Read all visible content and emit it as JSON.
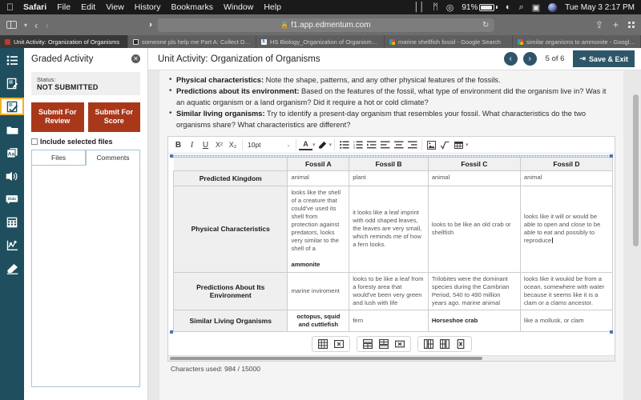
{
  "menubar": {
    "apple": "apple-logo",
    "items": [
      {
        "label": "Safari",
        "bold": true
      },
      {
        "label": "File",
        "bold": false
      },
      {
        "label": "Edit",
        "bold": false
      },
      {
        "label": "View",
        "bold": false
      },
      {
        "label": "History",
        "bold": false
      },
      {
        "label": "Bookmarks",
        "bold": false
      },
      {
        "label": "Window",
        "bold": false
      },
      {
        "label": "Help",
        "bold": false
      }
    ],
    "status": {
      "airplay_glyph": "⑂",
      "bluetooth_glyph": "ᛗ",
      "timemachine_glyph": "◔",
      "battery_pct": "91%",
      "wifi_glyph": "◠",
      "search_glyph": "⌕",
      "controlcenter_glyph": "☷",
      "siri": "siri-dot",
      "datetime": "Tue May 3  2:17 PM"
    }
  },
  "browser": {
    "url": "f1.app.edmentum.com",
    "lock_glyph": "🔒",
    "reload_glyph": "↻",
    "back_glyph": "‹",
    "forward_glyph": "›",
    "share_glyph": "↑",
    "newtab_glyph": "+",
    "chevron_glyph": "⌄",
    "shield_glyph": "◑",
    "tabs": [
      {
        "label": "Unit Activity: Organization of Organisms",
        "favicon": "edmentum-icon",
        "active": true
      },
      {
        "label": "someone pls help me Part A: Collect Dat...",
        "favicon": "dark-doc-icon",
        "active": false
      },
      {
        "label": "HS Biology_Organization of Organisms_V...",
        "favicon": "edmentum-e-icon",
        "active": false
      },
      {
        "label": "marine shellfish fossil - Google Search",
        "favicon": "google-icon",
        "active": false
      },
      {
        "label": "similar organisms to ammonite - Google...",
        "favicon": "google-icon",
        "active": false
      }
    ]
  },
  "rail": {
    "items": [
      {
        "name": "list-icon",
        "selected": false
      },
      {
        "name": "assignment-edit-icon",
        "selected": false
      },
      {
        "name": "graded-activity-icon",
        "selected": true
      },
      {
        "name": "folder-icon",
        "selected": false
      },
      {
        "name": "glossary-icon",
        "selected": false
      },
      {
        "name": "text-to-speech-icon",
        "selected": false
      },
      {
        "name": "translate-icon",
        "selected": false
      },
      {
        "name": "calculator-icon",
        "selected": false
      },
      {
        "name": "graph-icon",
        "selected": false
      },
      {
        "name": "highlighter-icon",
        "selected": false
      }
    ]
  },
  "panel": {
    "title": "Graded Activity",
    "close_glyph": "✕",
    "status_label": "Status:",
    "status_value": "NOT SUBMITTED",
    "submit_review_label": "Submit For Review",
    "submit_score_label": "Submit For Score",
    "include_files_label": "Include selected files",
    "tabs": [
      {
        "label": "Files",
        "active": false
      },
      {
        "label": "Comments",
        "active": true
      }
    ]
  },
  "header": {
    "title": "Unit Activity: Organization of Organisms",
    "prev_glyph": "‹",
    "next_glyph": "›",
    "page_indicator": "5 of 6",
    "save_exit_label": "Save & Exit",
    "save_exit_glyph": "⇥"
  },
  "instructions": [
    {
      "bold": "Physical characteristics:",
      "text": " Note the shape, patterns, and any other physical features of the fossils."
    },
    {
      "bold": "Predictions about its environment:",
      "text": " Based on the features of the fossil, what type of environment did the organism live in? Was it an aquatic organism or a land organism? Did it require a hot or cold climate?"
    },
    {
      "bold": "Similar living organisms:",
      "text": " Try to identify a present-day organism that resembles your fossil. What characteristics do the two organisms share? What characteristics are different?"
    }
  ],
  "editor": {
    "toolbar": {
      "bold_label": "B",
      "italic_label": "I",
      "underline_label": "U",
      "superscript_label": "X²",
      "subscript_label": "X₂",
      "font_size": "10pt",
      "caret_glyph": "⌄",
      "text_color_label": "A",
      "highlight_glyph": "✎",
      "bullet_list": "bullet-list-icon",
      "numbered_list": "numbered-list-icon",
      "indent": "indent-icon",
      "align_left": "align-left-icon",
      "align_center": "align-center-icon",
      "align_right": "align-right-icon",
      "image": "insert-image-icon",
      "equation": "insert-equation-icon",
      "table": "insert-table-icon"
    },
    "table": {
      "corner": "",
      "columns": [
        "Fossil A",
        "Fossil B",
        "Fossil C",
        "Fossil D"
      ],
      "rows": [
        {
          "header": "Predicted Kingdom",
          "cells": [
            {
              "text": "animal",
              "bold": false
            },
            {
              "text": "plant",
              "bold": false
            },
            {
              "text": "animal",
              "bold": false
            },
            {
              "text": "animal",
              "bold": false
            }
          ]
        },
        {
          "header": "Physical Characteristics",
          "cells": [
            {
              "text": "looks like the shell of a creature that could've used its shell from protection against predators, looks very similar to the shell of a",
              "bold_tail": "ammonite"
            },
            {
              "text": "it looks like a leaf imprint with odd shaped leaves, the leaves are very small, which reminds me of how a fern looks.",
              "bold": false
            },
            {
              "text": "looks to be like an old crab or shellfish",
              "bold": false
            },
            {
              "text": "looks like it will or would be able to open and close to be able to eat and possibly to reproduce",
              "bold": false,
              "caret": true
            }
          ]
        },
        {
          "header": "Predictions About Its Environment",
          "cells": [
            {
              "text": "marine inviroment",
              "bold": false
            },
            {
              "text": "looks to be like a leaf from a foresty area that would've been very green and lush with life",
              "bold": false
            },
            {
              "text": "Trilobites were the dominant species during the Cambrian Period, 540 to 490 million years ago. marine animal",
              "bold": false
            },
            {
              "text": "looks like it woukid be from a ocean, somewhere with water because it seems like it is a clam or a clams ancestor.",
              "bold": false
            }
          ]
        },
        {
          "header": "Similar Living Organisms",
          "cells": [
            {
              "text": "octopus, squid and cuttlefish",
              "bold": true
            },
            {
              "text": "fern",
              "bold": false
            },
            {
              "text": "Horseshoe crab",
              "bold": true
            },
            {
              "text": "like a mollusk, or clam",
              "bold": false
            }
          ]
        }
      ]
    },
    "table_tools": [
      {
        "name": "table-properties-icon"
      },
      {
        "name": "delete-table-icon"
      },
      {
        "name": "insert-row-before-icon"
      },
      {
        "name": "insert-row-after-icon"
      },
      {
        "name": "delete-row-icon"
      },
      {
        "name": "insert-column-before-icon"
      },
      {
        "name": "insert-column-after-icon"
      },
      {
        "name": "delete-column-icon"
      }
    ],
    "char_count": "Characters used: 984 / 15000"
  }
}
